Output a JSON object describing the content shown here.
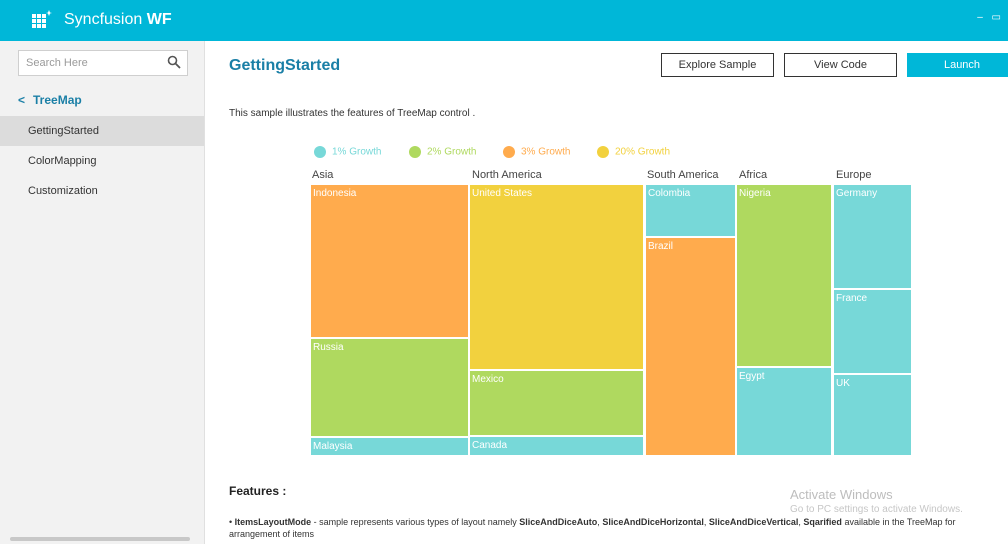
{
  "header": {
    "brand_light": "Syncfusion",
    "brand_bold": "WF",
    "window_controls": "– ▭",
    "logo_icon": "syncfusion-grid-logo",
    "color": "#00b7d8"
  },
  "sidebar": {
    "search_placeholder": "Search Here",
    "back_label": "TreeMap",
    "items": [
      "GettingStarted",
      "ColorMapping",
      "Customization"
    ],
    "active_index": 0
  },
  "main": {
    "title": "GettingStarted",
    "buttons": {
      "explore": "Explore Sample",
      "view_code": "View Code",
      "launch": "Launch"
    },
    "description": "This sample illustrates the features of TreeMap control .",
    "features_heading": "Features :",
    "feature_bullet": {
      "term": "ItemsLayoutMode",
      "text_a": " - sample represents various types of layout namely ",
      "layout1": "SliceAndDiceAuto",
      "layout2": "SliceAndDiceHorizontal",
      "layout3": "SliceAndDiceVertical",
      "layout4": "Sqarified",
      "text_b": " available in the TreeMap for arrangement of items"
    }
  },
  "treemap": {
    "legend": [
      {
        "label": "1% Growth",
        "color": "#77d8d8"
      },
      {
        "label": "2% Growth",
        "color": "#afd95f"
      },
      {
        "label": "3% Growth",
        "color": "#ffab4d"
      },
      {
        "label": "20% Growth",
        "color": "#f2d13e"
      }
    ],
    "groups": [
      "Asia",
      "North America",
      "South America",
      "Africa",
      "Europe"
    ],
    "items": [
      {
        "name": "Indonesia",
        "group": "Asia",
        "growth": "3% Growth"
      },
      {
        "name": "Russia",
        "group": "Asia",
        "growth": "2% Growth"
      },
      {
        "name": "Malaysia",
        "group": "Asia",
        "growth": "1% Growth"
      },
      {
        "name": "United States",
        "group": "North America",
        "growth": "20% Growth"
      },
      {
        "name": "Mexico",
        "group": "North America",
        "growth": "2% Growth"
      },
      {
        "name": "Canada",
        "group": "North America",
        "growth": "1% Growth"
      },
      {
        "name": "Colombia",
        "group": "South America",
        "growth": "1% Growth"
      },
      {
        "name": "Brazil",
        "group": "South America",
        "growth": "3% Growth"
      },
      {
        "name": "Nigeria",
        "group": "Africa",
        "growth": "2% Growth"
      },
      {
        "name": "Egypt",
        "group": "Africa",
        "growth": "1% Growth"
      },
      {
        "name": "Germany",
        "group": "Europe",
        "growth": "1% Growth"
      },
      {
        "name": "France",
        "group": "Europe",
        "growth": "1% Growth"
      },
      {
        "name": "UK",
        "group": "Europe",
        "growth": "1% Growth"
      }
    ]
  },
  "watermark": {
    "line1": "Activate Windows",
    "line2": "Go to PC settings to activate Windows."
  }
}
